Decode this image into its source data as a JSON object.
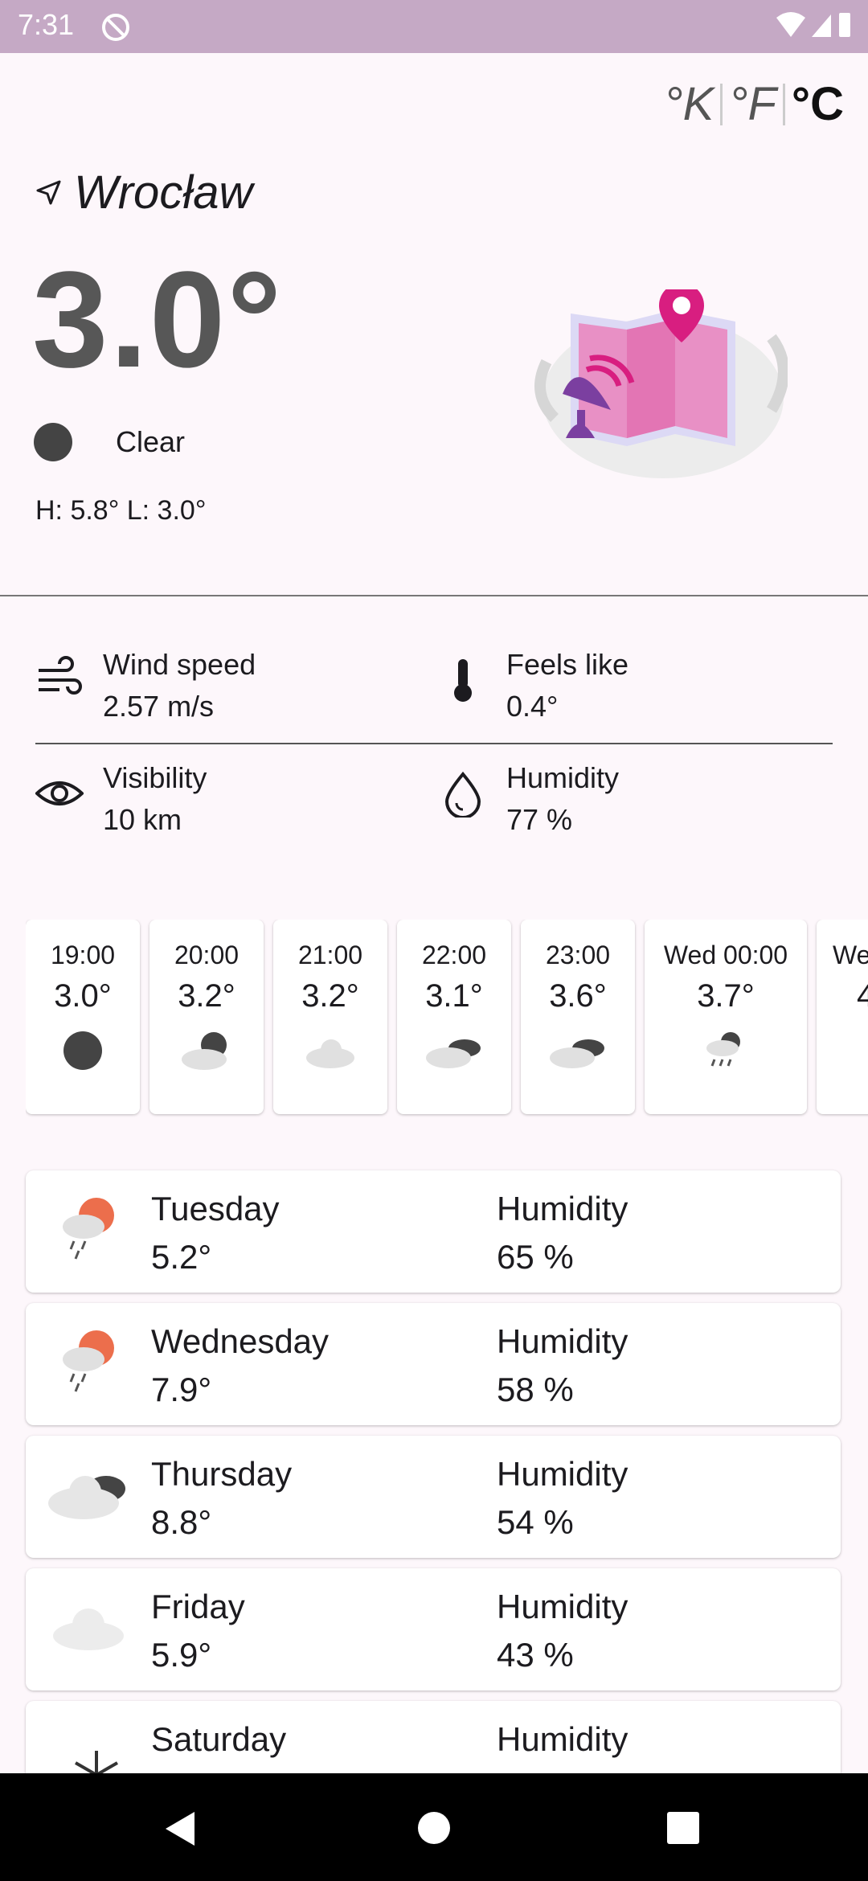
{
  "status": {
    "time": "7:31"
  },
  "units": {
    "kelvin": "°K",
    "fahrenheit": "°F",
    "celsius": "°C"
  },
  "current": {
    "city": "Wrocław",
    "temperature": "3.0°",
    "condition": "Clear",
    "hilo": "H: 5.8° L: 3.0°"
  },
  "details": {
    "wind": {
      "label": "Wind speed",
      "value": "2.57 m/s"
    },
    "feels": {
      "label": "Feels like",
      "value": "0.4°"
    },
    "visibility": {
      "label": "Visibility",
      "value": "10 km"
    },
    "humidity": {
      "label": "Humidity",
      "value": "77 %"
    }
  },
  "hourly": [
    {
      "time": "19:00",
      "temp": "3.0°",
      "icon": "clear-night-icon"
    },
    {
      "time": "20:00",
      "temp": "3.2°",
      "icon": "partly-cloudy-night-icon"
    },
    {
      "time": "21:00",
      "temp": "3.2°",
      "icon": "cloud-icon"
    },
    {
      "time": "22:00",
      "temp": "3.1°",
      "icon": "cloudy-night-icon"
    },
    {
      "time": "23:00",
      "temp": "3.6°",
      "icon": "cloudy-night-icon"
    },
    {
      "time": "Wed 00:00",
      "temp": "3.7°",
      "icon": "rain-night-icon"
    },
    {
      "time": "We",
      "temp": "4",
      "icon": ""
    }
  ],
  "daily": [
    {
      "day": "Tuesday",
      "temp": "5.2°",
      "humidity_label": "Humidity",
      "humidity": "65 %",
      "icon": "rain-sun-icon"
    },
    {
      "day": "Wednesday",
      "temp": "7.9°",
      "humidity_label": "Humidity",
      "humidity": "58 %",
      "icon": "rain-sun-icon"
    },
    {
      "day": "Thursday",
      "temp": "8.8°",
      "humidity_label": "Humidity",
      "humidity": "54 %",
      "icon": "cloudy-icon"
    },
    {
      "day": "Friday",
      "temp": "5.9°",
      "humidity_label": "Humidity",
      "humidity": "43 %",
      "icon": "cloud-icon"
    },
    {
      "day": "Saturday",
      "temp": "",
      "humidity_label": "Humidity",
      "humidity": "",
      "icon": "snow-icon"
    }
  ]
}
